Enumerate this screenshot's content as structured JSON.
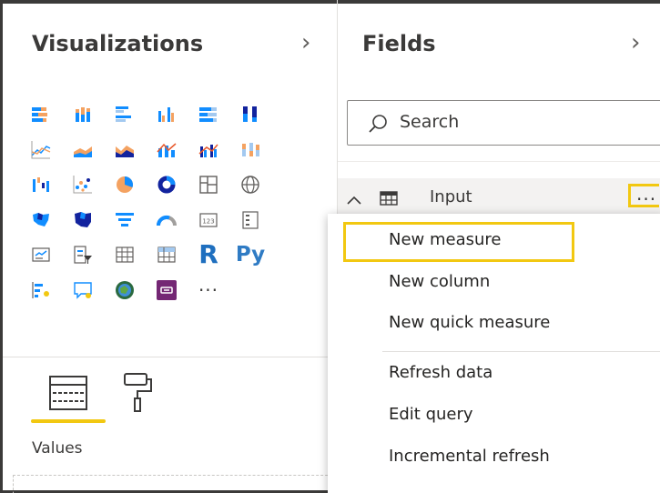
{
  "visualizations": {
    "title": "Visualizations",
    "expand_icon": "chevron-right-icon",
    "icons": [
      "stacked-bar-chart-icon",
      "stacked-column-chart-icon",
      "clustered-bar-chart-icon",
      "clustered-column-chart-icon",
      "100-stacked-bar-chart-icon",
      "100-stacked-column-chart-icon",
      "line-chart-icon",
      "area-chart-icon",
      "stacked-area-chart-icon",
      "line-and-stacked-column-chart-icon",
      "line-and-clustered-column-chart-icon",
      "ribbon-chart-icon",
      "waterfall-chart-icon",
      "scatter-chart-icon",
      "pie-chart-icon",
      "donut-chart-icon",
      "treemap-icon",
      "map-icon",
      "filled-map-icon",
      "shape-map-icon",
      "funnel-icon",
      "gauge-icon",
      "card-icon",
      "multi-row-card-icon",
      "kpi-icon",
      "slicer-icon",
      "table-icon",
      "matrix-icon",
      "r-script-visual-icon",
      "python-visual-icon",
      "key-influencers-icon",
      "qa-visual-icon",
      "arcgis-map-icon",
      "custom-visual-icon",
      "more-visuals-icon"
    ],
    "r_label": "R",
    "py_label": "Py",
    "more_label": "···",
    "tabs": [
      "fields-tab-icon",
      "format-paintroller-icon"
    ],
    "values_label": "Values"
  },
  "fields": {
    "title": "Fields",
    "expand_icon": "chevron-right-icon",
    "search_placeholder": "Search",
    "table": {
      "name": "Input",
      "more_label": "..."
    }
  },
  "context_menu": {
    "items": [
      {
        "label": "New measure",
        "highlighted": true
      },
      {
        "label": "New column"
      },
      {
        "label": "New quick measure"
      },
      {
        "label": "Refresh data"
      },
      {
        "label": "Edit query"
      },
      {
        "label": "Incremental refresh"
      }
    ]
  },
  "colors": {
    "accent": "#f2c811",
    "chart_blue": "#118dff",
    "chart_orange": "#f4a261",
    "chart_navy": "#12239e"
  }
}
